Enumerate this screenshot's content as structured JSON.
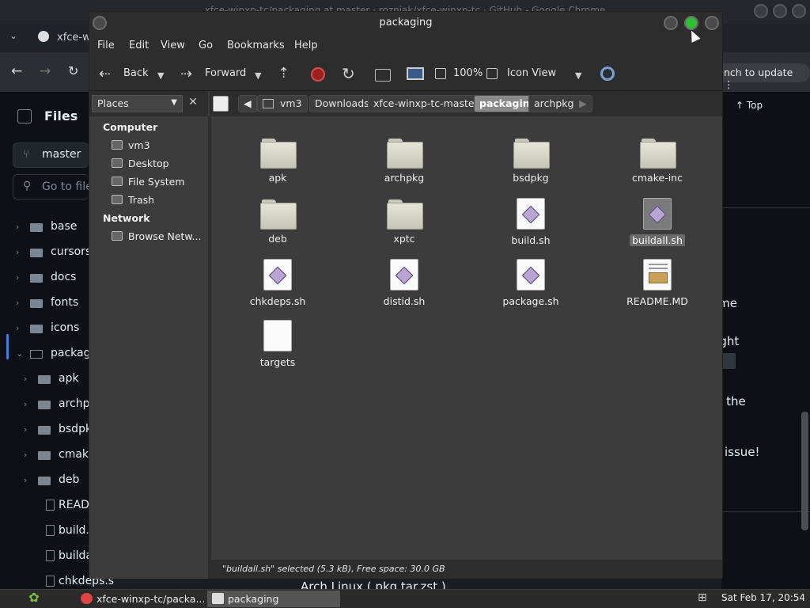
{
  "background_browser": {
    "title": "xfce-winxp-tc/packaging at master · rozniak/xfce-winxp-tc · GitHub - Google Chrome",
    "tab_label": "xfce-w",
    "update_button": "nch to update",
    "files_heading": "Files",
    "branch": "master",
    "goto_placeholder": "Go to file",
    "tree": [
      {
        "label": "base",
        "level": 0,
        "expanded": false
      },
      {
        "label": "cursors",
        "level": 0,
        "expanded": false
      },
      {
        "label": "docs",
        "level": 0,
        "expanded": false
      },
      {
        "label": "fonts",
        "level": 0,
        "expanded": false
      },
      {
        "label": "icons",
        "level": 0,
        "expanded": false
      },
      {
        "label": "packagi",
        "level": 0,
        "expanded": true
      },
      {
        "label": "apk",
        "level": 1
      },
      {
        "label": "archpk",
        "level": 1
      },
      {
        "label": "bsdpkg",
        "level": 1
      },
      {
        "label": "cmake",
        "level": 1
      },
      {
        "label": "deb",
        "level": 1
      },
      {
        "label": "READ",
        "level": 1,
        "file": true
      },
      {
        "label": "build.s",
        "level": 1,
        "file": true
      },
      {
        "label": "buildal",
        "level": 1,
        "file": true
      },
      {
        "label": "chkdeps.s",
        "level": 1,
        "file": true
      }
    ],
    "main_fragments": [
      "ime",
      "aight",
      "er the",
      "issue!",
      "Arch Linux ( pkg.tar.zst )"
    ],
    "top_button": "Top"
  },
  "file_manager": {
    "title": "packaging",
    "menu": [
      "File",
      "Edit",
      "View",
      "Go",
      "Bookmarks",
      "Help"
    ],
    "toolbar": {
      "back": "Back",
      "forward": "Forward",
      "zoom": "100%",
      "view_mode": "Icon View"
    },
    "places_combo": "Places",
    "places": {
      "computer_header": "Computer",
      "computer_items": [
        "vm3",
        "Desktop",
        "File System",
        "Trash"
      ],
      "network_header": "Network",
      "network_items": [
        "Browse Netw..."
      ]
    },
    "breadcrumbs": [
      "vm3",
      "Downloads",
      "xfce-winxp-tc-master",
      "packaging",
      "archpkg"
    ],
    "active_crumb": "packaging",
    "items": [
      {
        "name": "apk",
        "type": "folder"
      },
      {
        "name": "archpkg",
        "type": "folder"
      },
      {
        "name": "bsdpkg",
        "type": "folder"
      },
      {
        "name": "cmake-inc",
        "type": "folder"
      },
      {
        "name": "deb",
        "type": "folder"
      },
      {
        "name": "xptc",
        "type": "folder"
      },
      {
        "name": "build.sh",
        "type": "script"
      },
      {
        "name": "buildall.sh",
        "type": "script",
        "selected": true
      },
      {
        "name": "chkdeps.sh",
        "type": "script"
      },
      {
        "name": "distid.sh",
        "type": "script"
      },
      {
        "name": "package.sh",
        "type": "script"
      },
      {
        "name": "README.MD",
        "type": "text"
      },
      {
        "name": "targets",
        "type": "blank"
      }
    ],
    "status": "\"buildall.sh\" selected (5.3 kB), Free space: 30.0 GB"
  },
  "taskbar": {
    "tasks": [
      {
        "label": "xfce-winxp-tc/packa...",
        "active": false
      },
      {
        "label": "packaging",
        "active": true
      }
    ],
    "clock": "Sat Feb 17, 20:54"
  },
  "colors": {
    "window_bg": "#3c3c3c",
    "chrome_bg": "#2d2d2d",
    "selection": "#6a6a6a",
    "github_bg": "#0d1117"
  }
}
